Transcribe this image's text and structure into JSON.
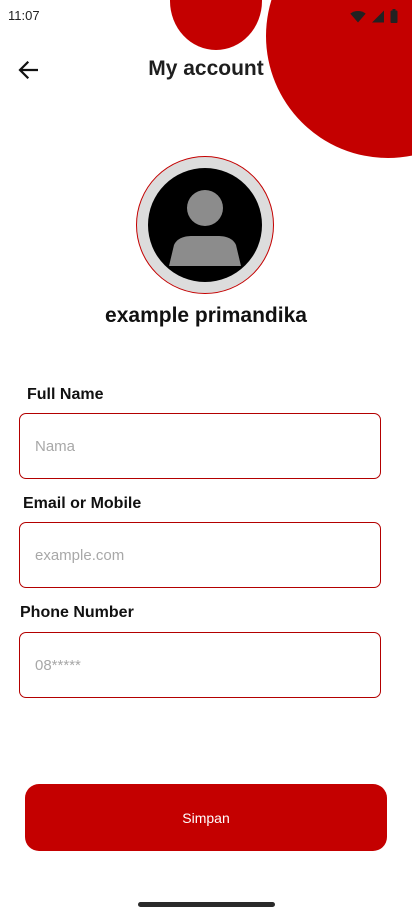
{
  "status_bar": {
    "time": "11:07",
    "icons": [
      "wifi-icon",
      "cellular-signal-icon",
      "battery-icon"
    ]
  },
  "header": {
    "title": "My account",
    "back_icon": "arrow-left-icon"
  },
  "profile": {
    "avatar_icon": "person-icon",
    "name": "example primandika"
  },
  "form": {
    "full_name": {
      "label": "Full Name",
      "value": "",
      "placeholder": "Nama"
    },
    "email": {
      "label": "Email or Mobile",
      "value": "",
      "placeholder": "example.com"
    },
    "phone": {
      "label": "Phone Number",
      "value": "",
      "placeholder": "08*****"
    }
  },
  "actions": {
    "save_label": "Simpan"
  },
  "colors": {
    "accent": "#c40000",
    "input_border": "#b30000",
    "avatar_ring": "#dcdcdc",
    "placeholder": "#a8a8a8"
  }
}
